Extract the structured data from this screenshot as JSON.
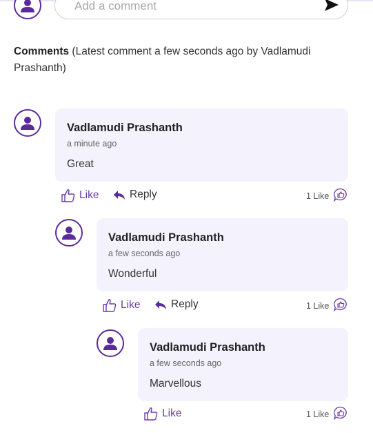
{
  "composer": {
    "placeholder": "Add a comment"
  },
  "heading": {
    "label": "Comments",
    "summary": "(Latest comment a few seconds ago by Vadlamudi Prashanth)"
  },
  "comments": [
    {
      "author": "Vadlamudi Prashanth",
      "time": "a minute ago",
      "text": "Great",
      "like_label": "Like",
      "reply_label": "Reply",
      "like_count": "1 Like"
    },
    {
      "author": "Vadlamudi Prashanth",
      "time": "a few seconds ago",
      "text": "Wonderful",
      "like_label": "Like",
      "reply_label": "Reply",
      "like_count": "1 Like"
    },
    {
      "author": "Vadlamudi Prashanth",
      "time": "a few seconds ago",
      "text": "Marvellous",
      "like_label": "Like",
      "like_count": "1 Like"
    }
  ],
  "colors": {
    "accent": "#5b2a9b",
    "bubble": "#f3f2fd"
  },
  "icons": [
    "user-icon",
    "send-icon",
    "thumbs-up-icon",
    "reply-arrow-icon",
    "like-bubble-icon"
  ]
}
